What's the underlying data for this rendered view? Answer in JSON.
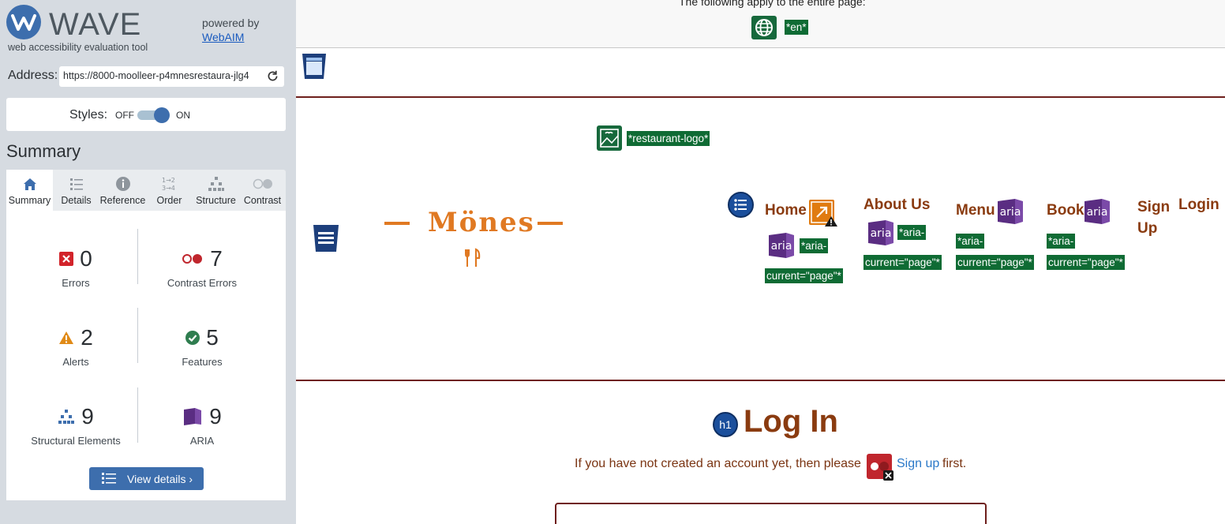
{
  "wave": {
    "logo_text": "WAVE",
    "tagline": "web accessibility evaluation tool",
    "powered_by": "powered by",
    "powered_link": "WebAIM",
    "address_label": "Address:",
    "address_value": "https://8000-moolleer-p4mnesrestaura-jlg4",
    "styles_label": "Styles:",
    "styles_off": "OFF",
    "styles_on": "ON",
    "summary_title": "Summary",
    "tabs": [
      {
        "label": "Summary",
        "icon": "home-icon"
      },
      {
        "label": "Details",
        "icon": "list-icon"
      },
      {
        "label": "Reference",
        "icon": "info-icon"
      },
      {
        "label": "Order",
        "icon": "order-icon"
      },
      {
        "label": "Structure",
        "icon": "structure-icon"
      },
      {
        "label": "Contrast",
        "icon": "contrast-icon"
      }
    ],
    "stats": {
      "errors": {
        "count": "0",
        "label": "Errors"
      },
      "contrast": {
        "count": "7",
        "label": "Contrast Errors"
      },
      "alerts": {
        "count": "2",
        "label": "Alerts"
      },
      "features": {
        "count": "5",
        "label": "Features"
      },
      "structural": {
        "count": "9",
        "label": "Structural Elements"
      },
      "aria": {
        "count": "9",
        "label": "ARIA"
      }
    },
    "view_details": "View details ›",
    "colors": {
      "accent": "#3d6ead",
      "error": "#d2232a",
      "alert": "#e08a17",
      "feature": "#2f7d4f",
      "aria": "#5a2d82"
    }
  },
  "page": {
    "top_note": "The following apply to the entire page:",
    "lang_tag": "*en*",
    "logo_tag": "*restaurant-logo*",
    "brand_text": "Mönes",
    "nav": [
      {
        "label": "Home"
      },
      {
        "label": "About Us"
      },
      {
        "label": "Menu"
      },
      {
        "label": "Book"
      },
      {
        "label": "Sign Up"
      },
      {
        "label": "Login"
      }
    ],
    "aria_tag_part1": "*aria-",
    "aria_tag_part2": "current=\"page\"*",
    "aria_badge": "aria",
    "h1_badge": "h1",
    "heading": "Log In",
    "sub_text": "If you have not created an account yet, then please",
    "signup_link": "Sign up",
    "first_text": "first.",
    "colors": {
      "nav": "#8a3b10",
      "brand": "#e07922",
      "tag_bg": "#0f6b34",
      "rule": "#6e1f1c"
    }
  }
}
